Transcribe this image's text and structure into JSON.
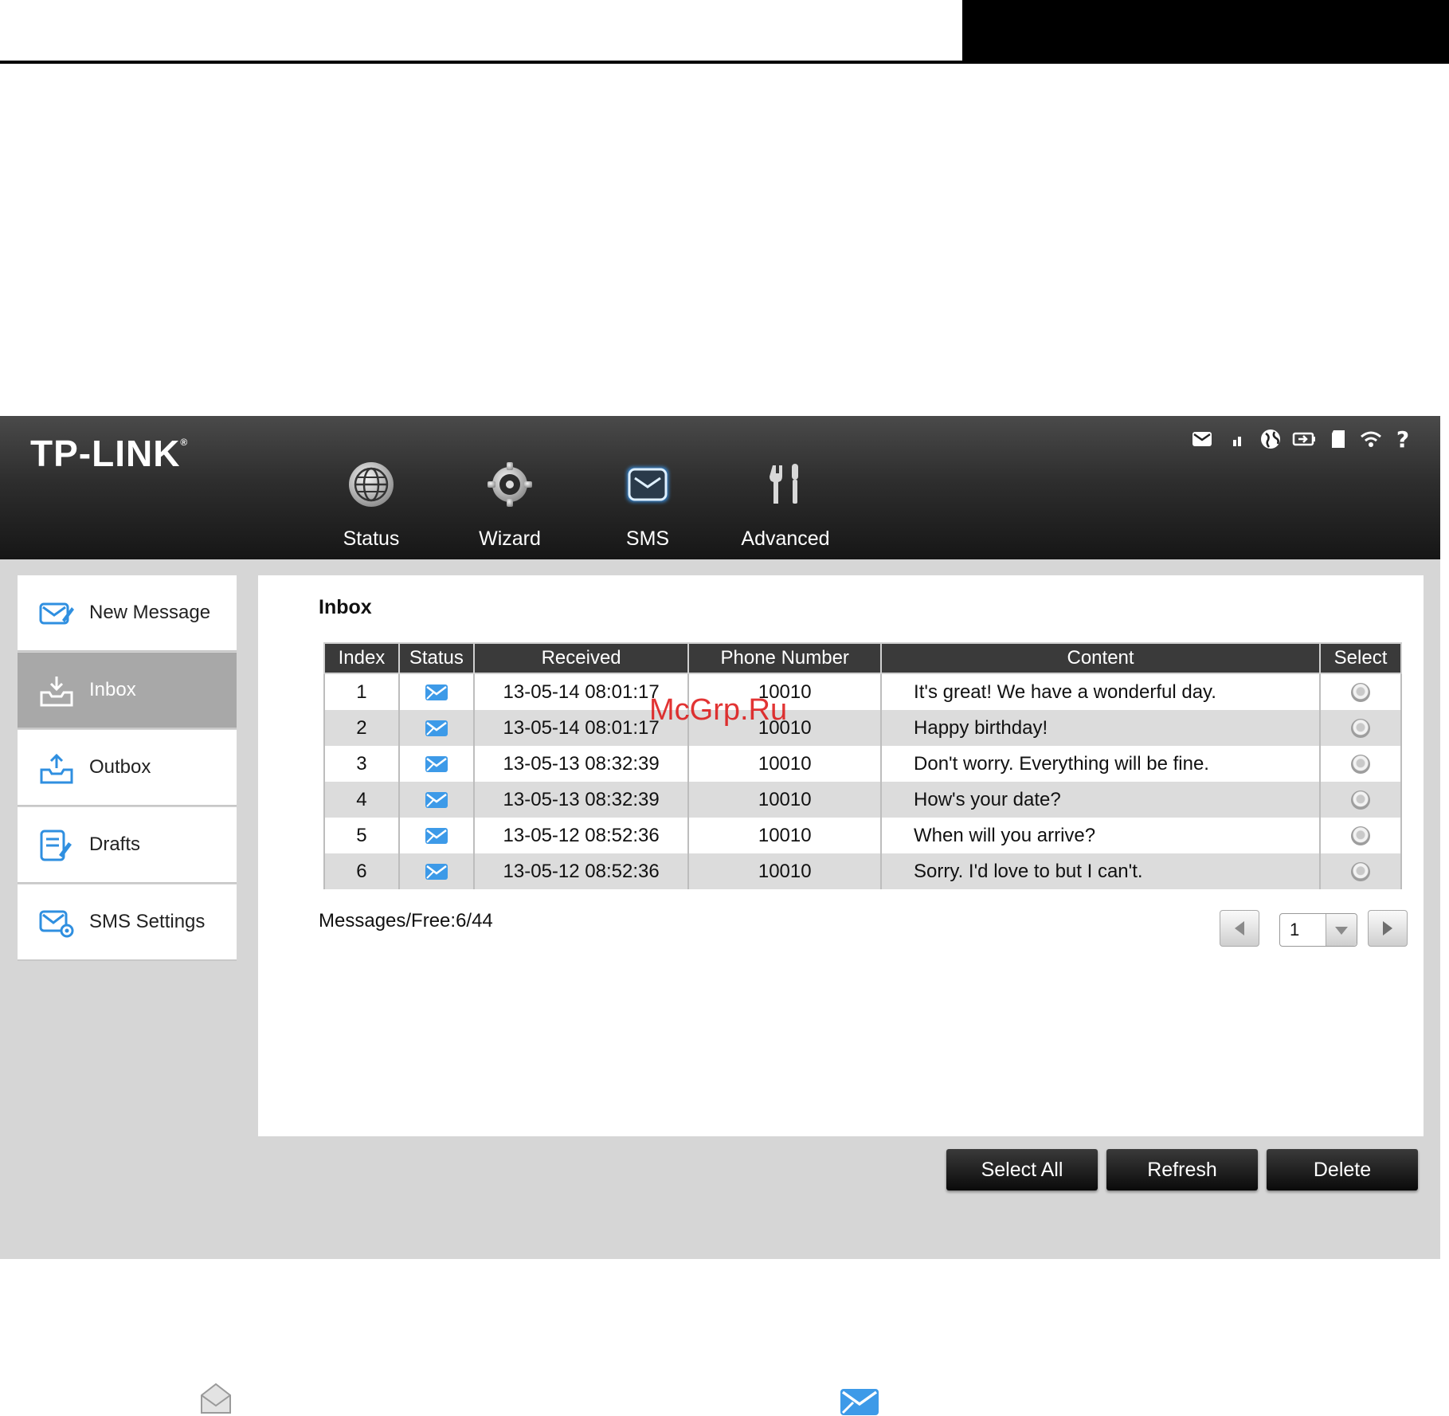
{
  "brand": {
    "logo_text": "TP-LINK",
    "registered_mark": "®"
  },
  "top_nav": [
    {
      "label": "Status",
      "icon": "globe-icon"
    },
    {
      "label": "Wizard",
      "icon": "gear-icon"
    },
    {
      "label": "SMS",
      "icon": "envelope-icon",
      "active": true
    },
    {
      "label": "Advanced",
      "icon": "tools-icon"
    }
  ],
  "status_icons": [
    "message-icon",
    "signal-icon",
    "internet-icon",
    "battery-icon",
    "sd-card-icon",
    "wifi-icon",
    "help-icon"
  ],
  "sidebar": {
    "items": [
      {
        "label": "New Message",
        "icon": "new-message-icon"
      },
      {
        "label": "Inbox",
        "icon": "inbox-icon",
        "active": true
      },
      {
        "label": "Outbox",
        "icon": "outbox-icon"
      },
      {
        "label": "Drafts",
        "icon": "drafts-icon"
      },
      {
        "label": "SMS Settings",
        "icon": "sms-settings-icon"
      }
    ]
  },
  "inbox": {
    "title": "Inbox",
    "columns": [
      "Index",
      "Status",
      "Received",
      "Phone Number",
      "Content",
      "Select"
    ],
    "rows": [
      {
        "index": "1",
        "status": "unread",
        "received": "13-05-14 08:01:17",
        "phone": "10010",
        "content": "It's great! We have a wonderful day."
      },
      {
        "index": "2",
        "status": "unread",
        "received": "13-05-14 08:01:17",
        "phone": "10010",
        "content": "Happy birthday!"
      },
      {
        "index": "3",
        "status": "unread",
        "received": "13-05-13 08:32:39",
        "phone": "10010",
        "content": "Don't worry. Everything will be fine."
      },
      {
        "index": "4",
        "status": "unread",
        "received": "13-05-13 08:32:39",
        "phone": "10010",
        "content": "How's your date?"
      },
      {
        "index": "5",
        "status": "unread",
        "received": "13-05-12 08:52:36",
        "phone": "10010",
        "content": "When will you arrive?"
      },
      {
        "index": "6",
        "status": "unread",
        "received": "13-05-12 08:52:36",
        "phone": "10010",
        "content": "Sorry. I'd love to but I can't."
      }
    ],
    "messages_free": "Messages/Free:6/44",
    "page_selected": "1"
  },
  "actions": {
    "select_all": "Select All",
    "refresh": "Refresh",
    "delete": "Delete"
  },
  "watermark": "McGrp.Ru",
  "colors": {
    "accent_blue": "#2f8fe0",
    "header_dark": "#1a1a1a",
    "panel_gray": "#d6d6d6",
    "watermark_red": "#dd1111"
  }
}
